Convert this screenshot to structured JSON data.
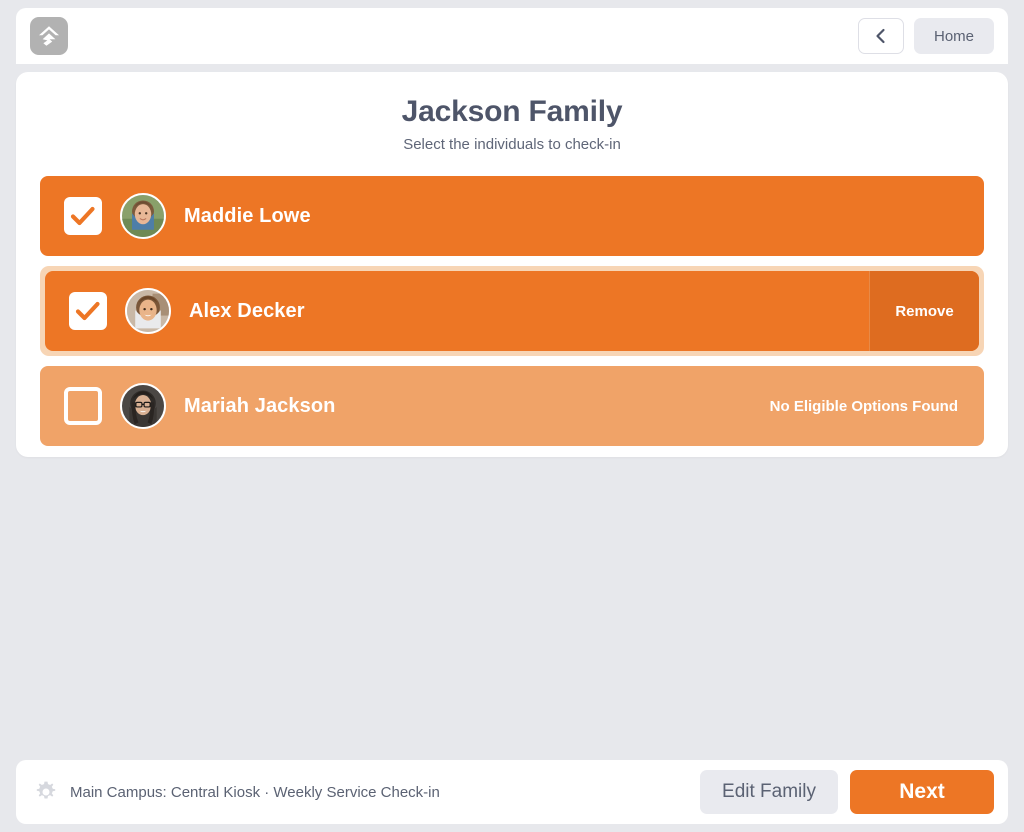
{
  "header": {
    "logo_icon": "app-logo-arrow-icon",
    "back_icon": "chevron-left-icon",
    "back_label": "",
    "home_label": "Home"
  },
  "main": {
    "title": "Jackson Family",
    "subtitle": "Select the individuals to check-in",
    "people": [
      {
        "name": "Maddie Lowe",
        "checked": true,
        "state": "selected",
        "status_text": "",
        "action_label": "",
        "highlighted": false,
        "avatar_icon": "avatar-photo-child-girl"
      },
      {
        "name": "Alex Decker",
        "checked": true,
        "state": "selected",
        "status_text": "",
        "action_label": "Remove",
        "highlighted": true,
        "avatar_icon": "avatar-photo-child-girl-smiling"
      },
      {
        "name": "Mariah Jackson",
        "checked": false,
        "state": "unavailable",
        "status_text": "No Eligible Options Found",
        "action_label": "",
        "highlighted": false,
        "avatar_icon": "avatar-photo-woman-glasses"
      }
    ]
  },
  "footer": {
    "gear_icon": "gear-icon",
    "kiosk_info": "Main Campus: Central Kiosk · Weekly Service Check-in",
    "edit_family_label": "Edit Family",
    "next_label": "Next"
  },
  "colors": {
    "accent_orange": "#ed7625",
    "accent_orange_muted": "#f0a368",
    "accent_orange_dark": "#de6c20",
    "page_background": "#e7e8ec",
    "card_background": "#ffffff",
    "text_slate": "#4e5569",
    "button_grey": "#e9eaef"
  }
}
